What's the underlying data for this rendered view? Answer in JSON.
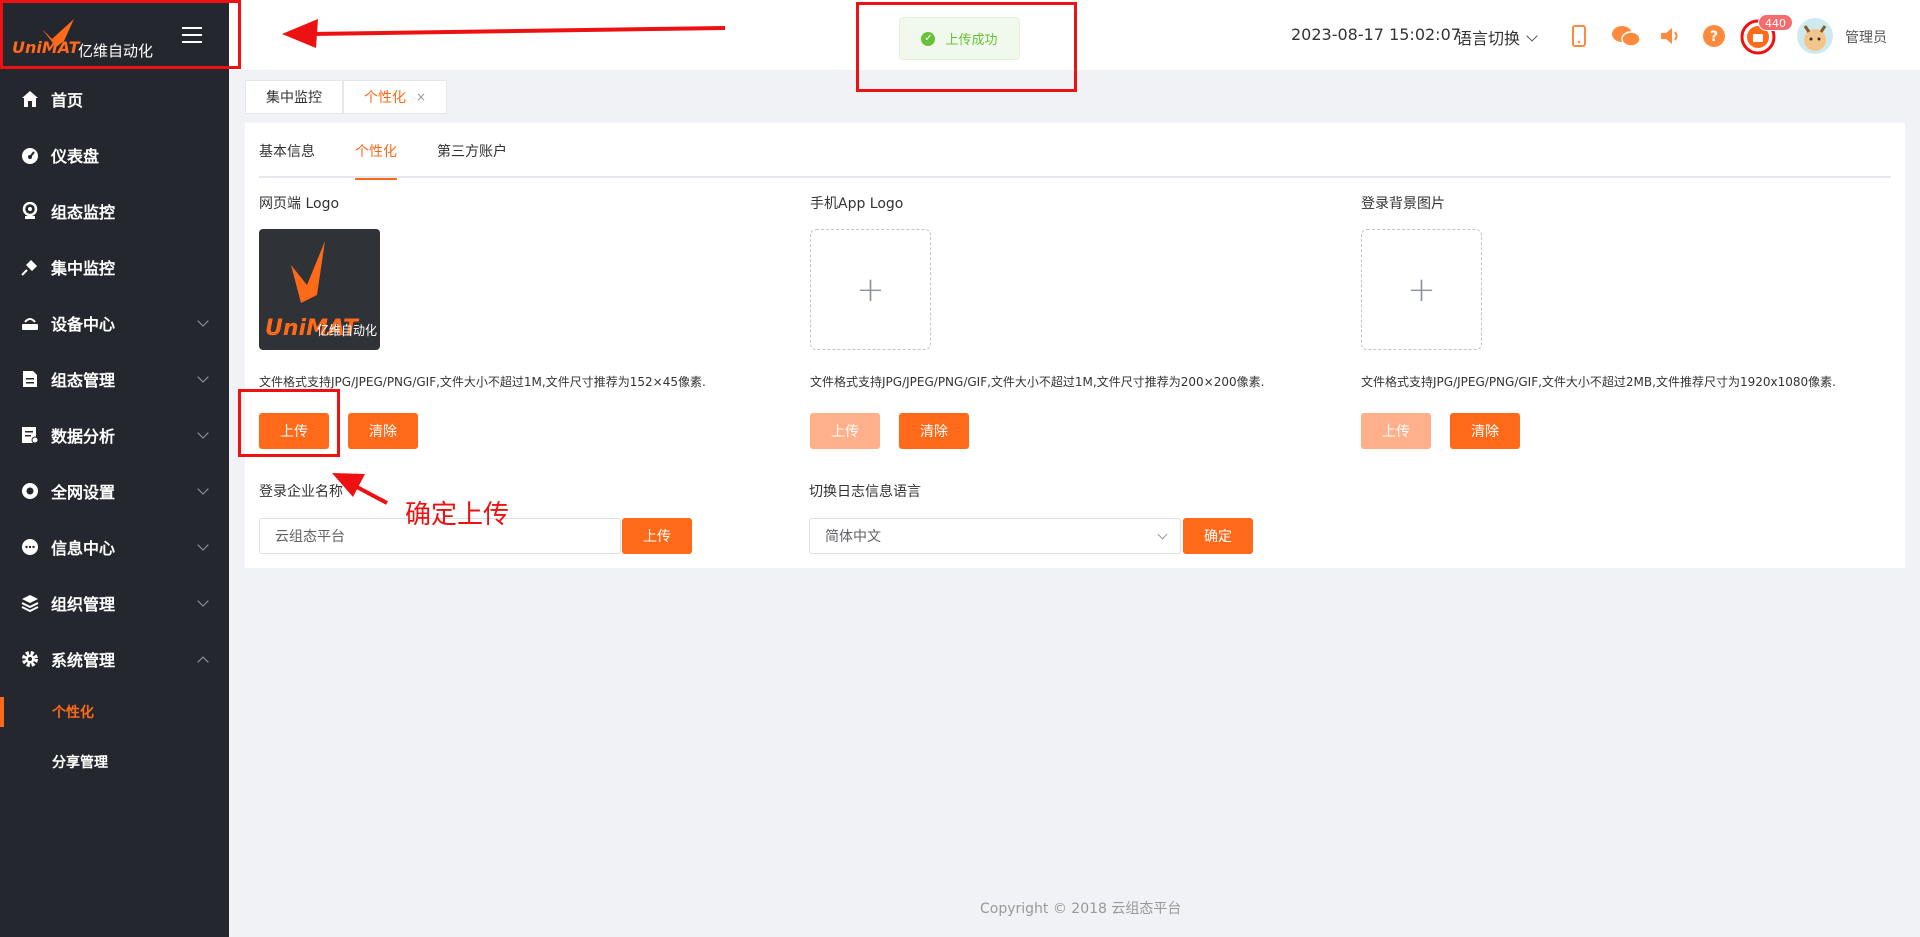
{
  "brand": {
    "logo_word": "UniMAT",
    "name": "亿维自动化"
  },
  "sidebar": {
    "items": [
      {
        "label": "首页",
        "icon": "home-icon",
        "expandable": false
      },
      {
        "label": "仪表盘",
        "icon": "dashboard-icon",
        "expandable": false
      },
      {
        "label": "组态监控",
        "icon": "monitor-icon",
        "expandable": false
      },
      {
        "label": "集中监控",
        "icon": "satellite-icon",
        "expandable": false
      },
      {
        "label": "设备中心",
        "icon": "router-icon",
        "expandable": true
      },
      {
        "label": "组态管理",
        "icon": "document-icon",
        "expandable": true
      },
      {
        "label": "数据分析",
        "icon": "analytics-icon",
        "expandable": true
      },
      {
        "label": "全网设置",
        "icon": "globe-icon",
        "expandable": true
      },
      {
        "label": "信息中心",
        "icon": "chat-icon",
        "expandable": true
      },
      {
        "label": "组织管理",
        "icon": "layers-icon",
        "expandable": true
      },
      {
        "label": "系统管理",
        "icon": "gear-icon",
        "expandable": true,
        "expanded": true
      }
    ],
    "subitems": [
      {
        "label": "个性化",
        "active": true
      },
      {
        "label": "分享管理",
        "active": false
      }
    ]
  },
  "header": {
    "toast": "上传成功",
    "datetime": "2023-08-17 15:02:07",
    "language": "语言切换",
    "alarm_count": "440",
    "username": "管理员"
  },
  "tabs": [
    {
      "label": "集中监控",
      "active": false,
      "closable": false
    },
    {
      "label": "个性化",
      "active": true,
      "closable": true,
      "close": "×"
    }
  ],
  "inner_tabs": [
    {
      "label": "基本信息",
      "active": false
    },
    {
      "label": "个性化",
      "active": true
    },
    {
      "label": "第三方账户",
      "active": false
    }
  ],
  "uploads": [
    {
      "title": "网页端 Logo",
      "hint": "文件格式支持JPG/JPEG/PNG/GIF,文件大小不超过1M,文件尺寸推荐为152×45像素.",
      "upload": "上传",
      "clear": "清除",
      "has_image": true,
      "upload_enabled": true
    },
    {
      "title": "手机App Logo",
      "hint": "文件格式支持JPG/JPEG/PNG/GIF,文件大小不超过1M,文件尺寸推荐为200×200像素.",
      "upload": "上传",
      "clear": "清除",
      "has_image": false,
      "upload_enabled": false
    },
    {
      "title": "登录背景图片",
      "hint": "文件格式支持JPG/JPEG/PNG/GIF,文件大小不超过2MB,文件推荐尺寸为1920x1080像素.",
      "upload": "上传",
      "clear": "清除",
      "has_image": false,
      "upload_enabled": false
    }
  ],
  "company": {
    "label": "登录企业名称",
    "value": "云组态平台",
    "button": "上传"
  },
  "log_language": {
    "label": "切换日志信息语言",
    "value": "简体中文",
    "button": "确定"
  },
  "plus": "+",
  "footer": "Copyright © 2018 云组态平台",
  "annotation": "确定上传",
  "colors": {
    "accent": "#ff6a1a",
    "sidebar": "#24272e",
    "success": "#67c23a",
    "annotation": "#ee1111"
  }
}
